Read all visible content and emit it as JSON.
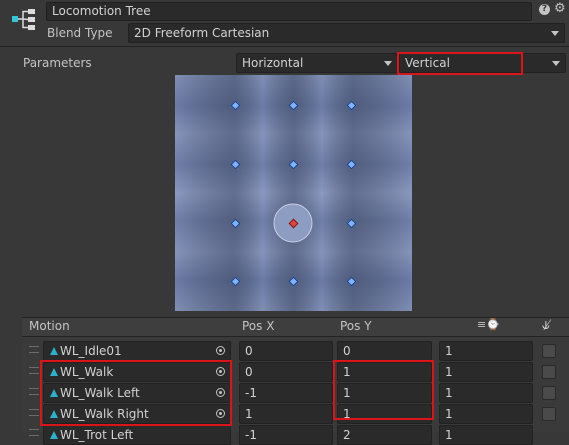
{
  "header": {
    "name_value": "Locomotion Tree",
    "blend_type_label": "Blend Type",
    "blend_type_value": "2D Freeform Cartesian"
  },
  "parameters": {
    "label": "Parameters",
    "x_param": "Horizontal",
    "y_param": "Vertical"
  },
  "table": {
    "columns": {
      "motion": "Motion",
      "pos_x": "Pos X",
      "pos_y": "Pos Y"
    },
    "rows": [
      {
        "motion": "WL_Idle01",
        "pos_x": "0",
        "pos_y": "0",
        "speed": "1"
      },
      {
        "motion": "WL_Walk",
        "pos_x": "0",
        "pos_y": "1",
        "speed": "1"
      },
      {
        "motion": "WL_Walk Left",
        "pos_x": "-1",
        "pos_y": "1",
        "speed": "1"
      },
      {
        "motion": "WL_Walk Right",
        "pos_x": "1",
        "pos_y": "1",
        "speed": "1"
      },
      {
        "motion": "WL_Trot Left",
        "pos_x": "-1",
        "pos_y": "2",
        "speed": "1"
      }
    ]
  },
  "colors": {
    "highlight": "#d9141b",
    "point": "#7fb2ff",
    "selected_point": "#e0443f"
  }
}
